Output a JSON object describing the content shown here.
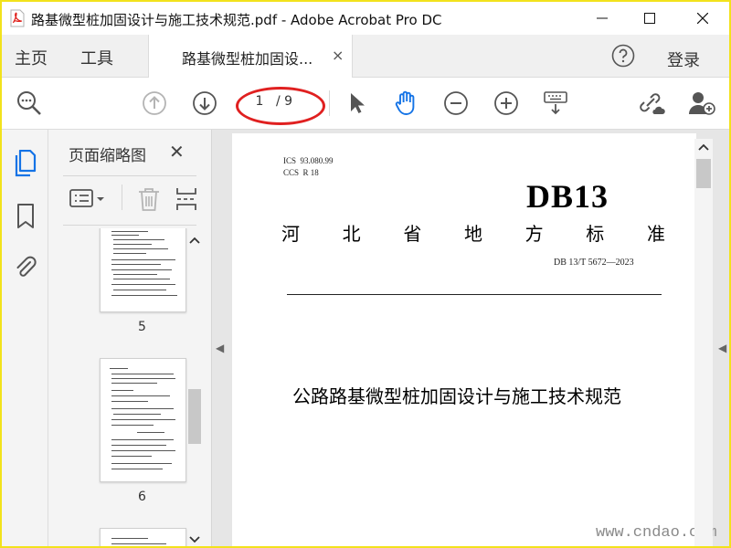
{
  "window": {
    "title": "路基微型桩加固设计与施工技术规范.pdf - Adobe Acrobat Pro DC"
  },
  "tabs": {
    "home": "主页",
    "tools": "工具",
    "doc_tab": "路基微型桩加固设...",
    "close_glyph": "×",
    "login": "登录"
  },
  "toolbar": {
    "current_page": "1",
    "page_total": "/ 9"
  },
  "sidebar": {
    "panel_title": "页面缩略图",
    "close_glyph": "✕",
    "thumbnails": [
      {
        "number": "5"
      },
      {
        "number": "6"
      }
    ]
  },
  "document": {
    "ics": "ICS  93.080.99",
    "ccs": "CCS  R 18",
    "db_logo": "DB13",
    "province_chars": [
      "河",
      "北",
      "省",
      "地",
      "方",
      "标",
      "准"
    ],
    "standard_number": "DB 13/T  5672—2023",
    "title": "公路路基微型桩加固设计与施工技术规范"
  },
  "watermark": "www.cndao.com",
  "colors": {
    "accent_blue": "#1473e6",
    "annotation_red": "#e02020",
    "frame_yellow": "#f2e21c"
  }
}
